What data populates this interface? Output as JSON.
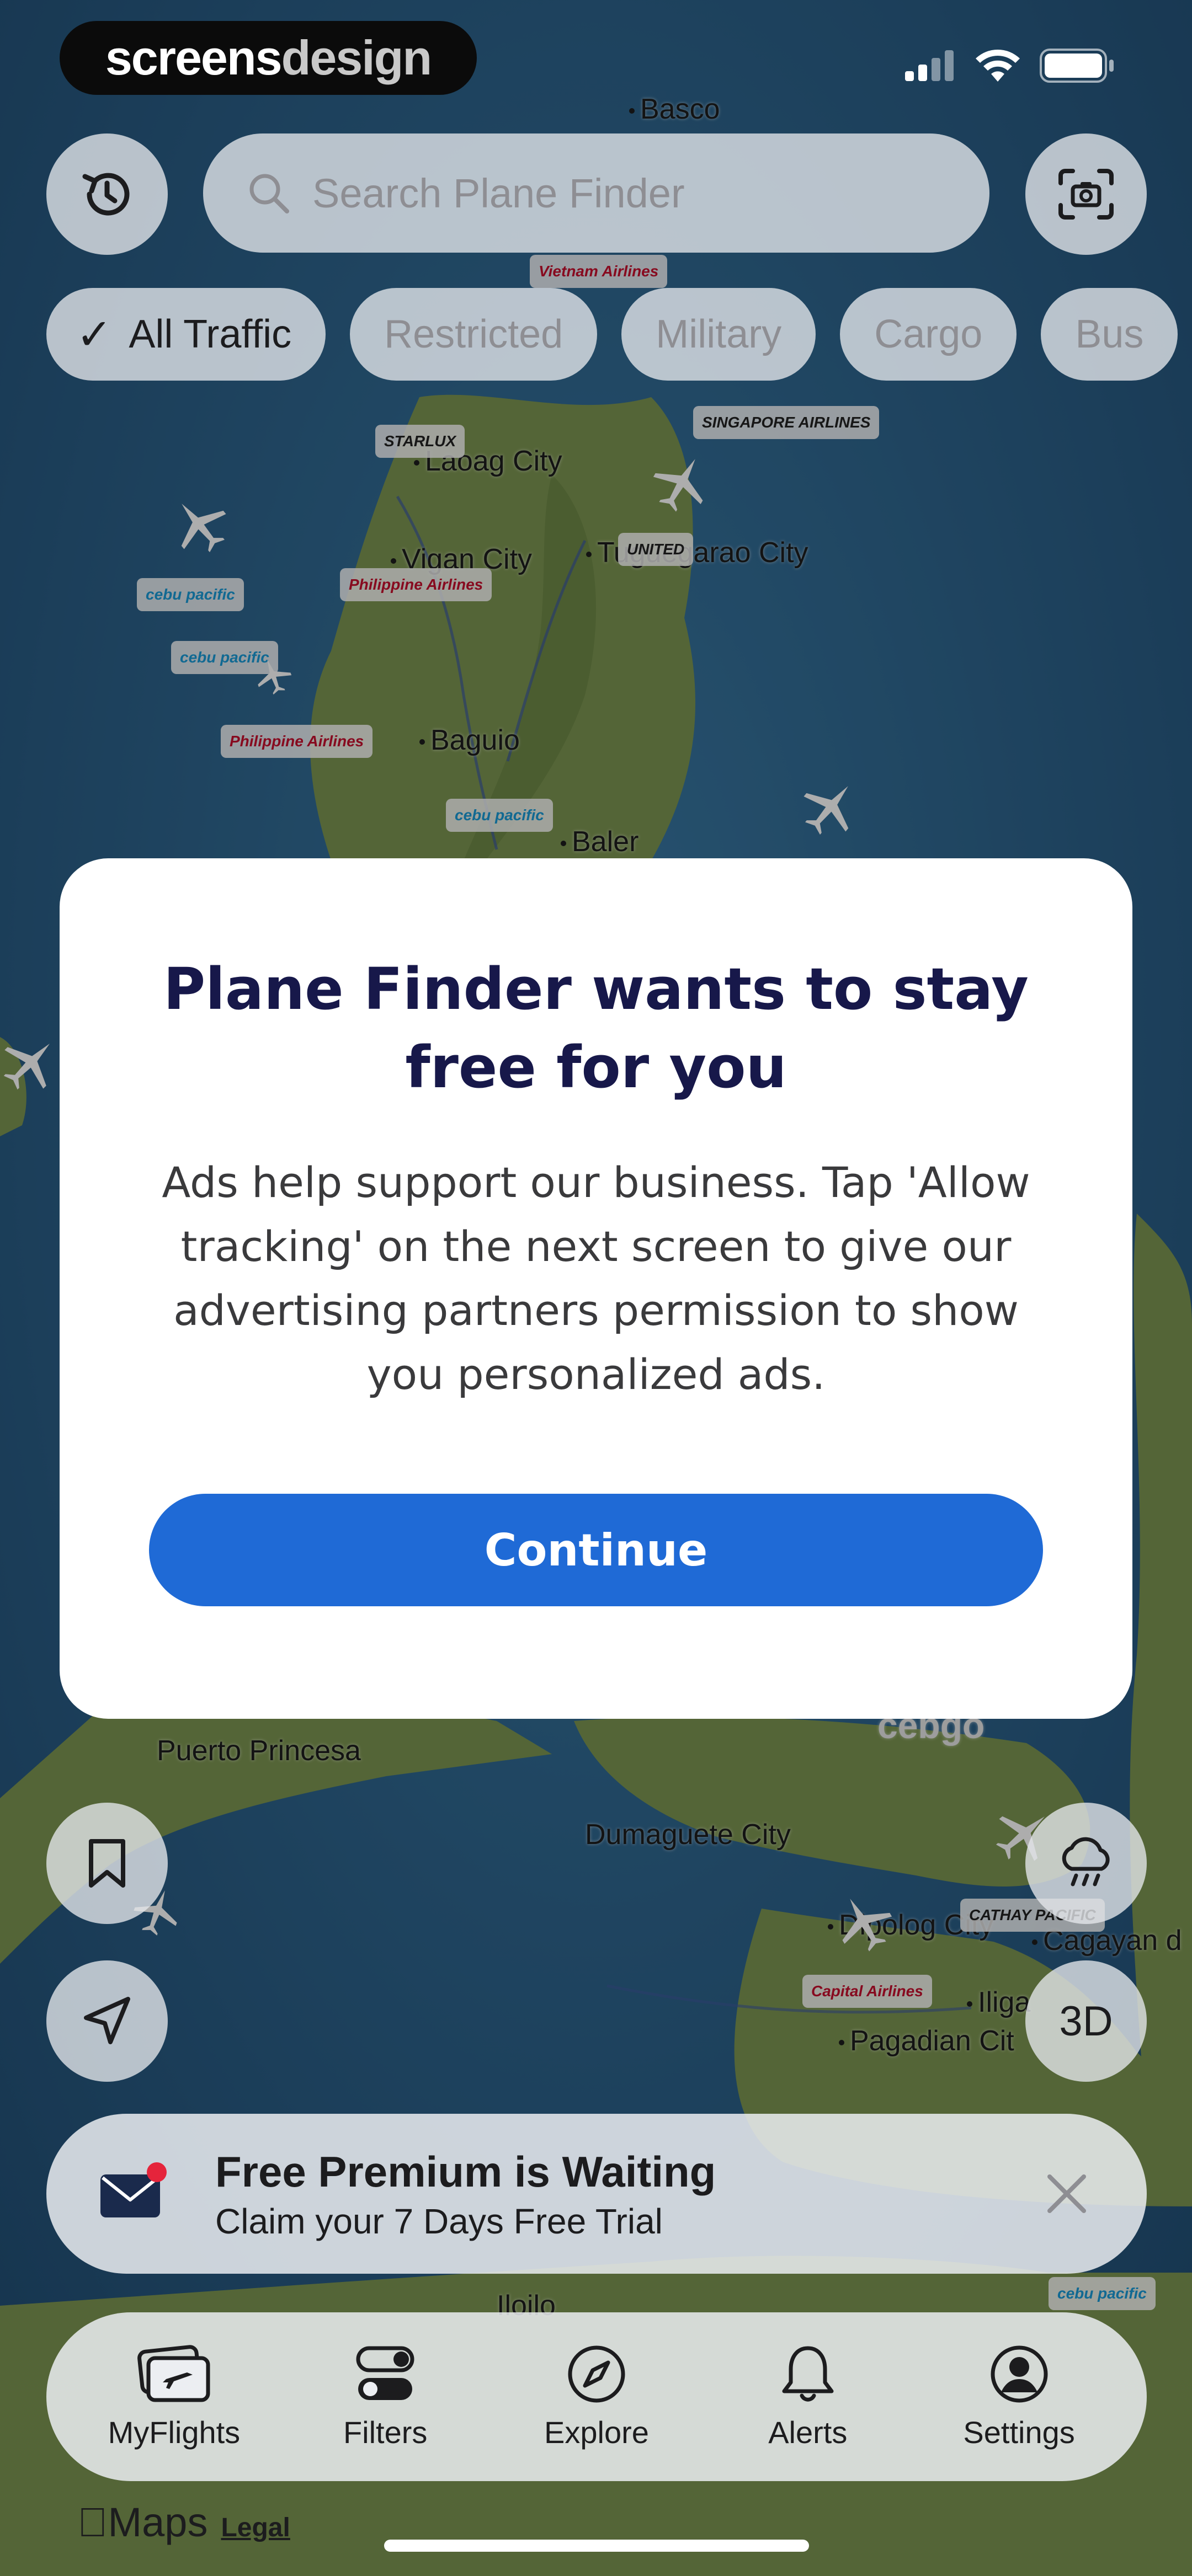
{
  "brand": {
    "part1": "screens",
    "part2": "design"
  },
  "search": {
    "placeholder": "Search Plane Finder"
  },
  "filters": [
    {
      "label": "All Traffic",
      "selected": true
    },
    {
      "label": "Restricted",
      "selected": false
    },
    {
      "label": "Military",
      "selected": false
    },
    {
      "label": "Cargo",
      "selected": false
    },
    {
      "label": "Bus",
      "selected": false
    }
  ],
  "map": {
    "places": [
      "Basco",
      "Laoag City",
      "Vigan City",
      "Tuguegarao City",
      "Baguio",
      "Baler",
      "Puerto Princesa",
      "Dumaguete City",
      "Dipolog City",
      "Cagayan d",
      "Iliga",
      "Pagadian Cit",
      "Iloilo",
      "cebgo"
    ],
    "airlines": [
      "STARLUX",
      "cebu pacific",
      "cebu pacific",
      "Philippine Airlines",
      "Philippine Airlines",
      "cebu pacific",
      "UNITED",
      "SINGAPORE AIRLINES",
      "Vietnam Airlines",
      "Capital Airlines",
      "CATHAY PACIFIC",
      "cebu pacific"
    ]
  },
  "modal": {
    "title": "Plane Finder wants to stay free for you",
    "body": "Ads help support our business. Tap 'Allow tracking' on the next screen to give our advertising partners permission to show you personalized ads.",
    "cta": "Continue"
  },
  "map_controls": {
    "three_d": "3D"
  },
  "promo": {
    "title": "Free Premium is Waiting",
    "subtitle": "Claim your 7 Days Free Trial"
  },
  "tabs": [
    {
      "label": "MyFlights",
      "icon": "ticket-plane-icon"
    },
    {
      "label": "Filters",
      "icon": "toggles-icon"
    },
    {
      "label": "Explore",
      "icon": "compass-icon"
    },
    {
      "label": "Alerts",
      "icon": "bell-icon"
    },
    {
      "label": "Settings",
      "icon": "person-circle-icon"
    }
  ],
  "credits": {
    "maps": "Maps",
    "legal": "Legal"
  },
  "colors": {
    "accent": "#1f6ad6",
    "modal_title": "#17184a",
    "sea": "#2d5f86",
    "land": "#7f9a55"
  }
}
